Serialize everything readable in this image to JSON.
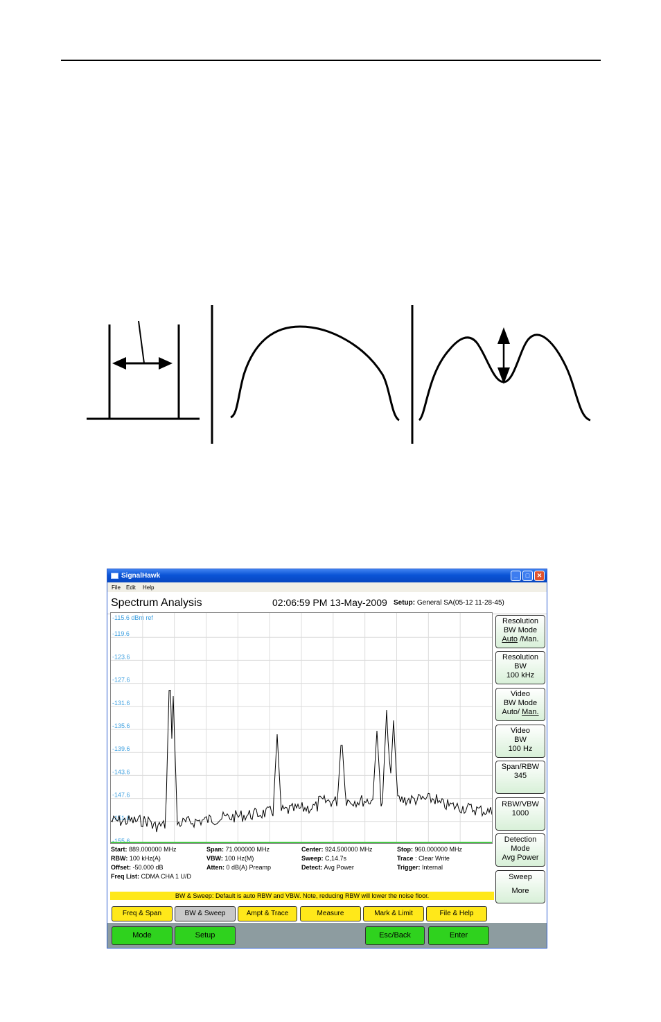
{
  "window": {
    "title": "SignalHawk",
    "min": "_",
    "max": "□",
    "close": "✕"
  },
  "menu": {
    "file": "File",
    "edit": "Edit",
    "help": "Help"
  },
  "header": {
    "title": "Spectrum Analysis",
    "datetime": "02:06:59 PM 13-May-2009",
    "setup_label": "Setup:",
    "setup_value": "General SA(05-12 11-28-45)"
  },
  "plot": {
    "ref_label": "-115.6 dBm ref",
    "y_ticks": [
      "-119.6",
      "-123.6",
      "-127.6",
      "-131.6",
      "-135.6",
      "-139.6",
      "-143.6",
      "-147.6",
      "-151.6",
      "-155.6"
    ]
  },
  "softkeys": [
    {
      "l1": "Resolution",
      "l2": "BW Mode",
      "l3a": "Auto",
      "l3b": " /Man."
    },
    {
      "l1": "Resolution",
      "l2": "BW",
      "l3": "100 kHz"
    },
    {
      "l1": "Video",
      "l2": "BW Mode",
      "l3a": "Auto/ ",
      "l3b": "Man."
    },
    {
      "l1": "Video",
      "l2": "BW",
      "l3": "100 Hz"
    },
    {
      "l1": "Span/RBW",
      "l2": "345"
    },
    {
      "l1": "RBW/VBW",
      "l2": "1000"
    },
    {
      "l1": "Detection",
      "l2": "Mode",
      "l3": "Avg Power"
    },
    {
      "l1": "Sweep",
      "l2": "More"
    }
  ],
  "info": {
    "start_l": "Start:",
    "start_v": " 889.000000 MHz",
    "span_l": "Span:",
    "span_v": " 71.000000 MHz",
    "center_l": "Center:",
    "center_v": " 924.500000 MHz",
    "stop_l": "Stop:",
    "stop_v": " 960.000000 MHz",
    "rbw_l": "RBW:",
    "rbw_v": " 100 kHz(A)",
    "vbw_l": "VBW:",
    "vbw_v": " 100 Hz(M)",
    "sweep_l": "Sweep:",
    "sweep_v": " C,14.7s",
    "trace_l": "Trace",
    "trace_v": " : Clear Write",
    "offset_l": "Offset:",
    "offset_v": " -50.000 dB",
    "atten_l": "Atten:",
    "atten_v": " 0 dB(A) Preamp",
    "detect_l": "Detect:",
    "detect_v": " Avg Power",
    "trigger_l": "Trigger:",
    "trigger_v": " Internal",
    "freq_l": "Freq List:",
    "freq_v": " CDMA CHA 1 U/D"
  },
  "hint": "BW & Sweep: Default is auto RBW and VBW. Note, reducing RBW will lower the noise floor.",
  "tabs": [
    "Freq & Span",
    "BW & Sweep",
    "Ampt & Trace",
    "Measure",
    "Mark & Limit",
    "File & Help"
  ],
  "nav": {
    "mode": "Mode",
    "setup": "Setup",
    "esc": "Esc/Back",
    "enter": "Enter"
  },
  "colors": {
    "tab": "#ffe81a",
    "tab_selected": "#c8c8c8",
    "nav_button": "#2fd21e",
    "tick_label": "#3ea0e0"
  }
}
